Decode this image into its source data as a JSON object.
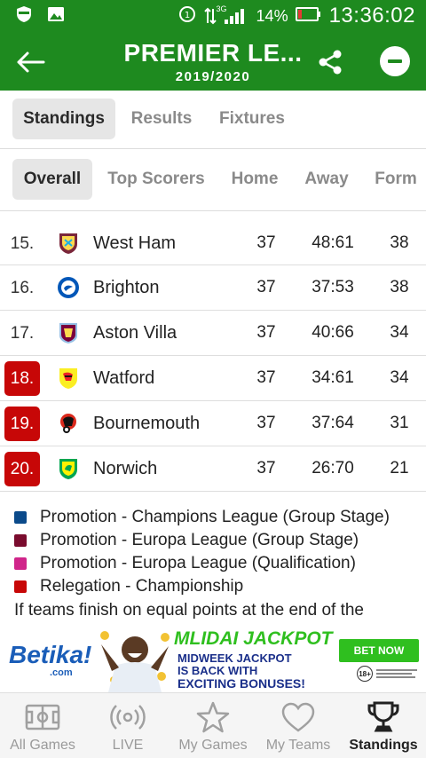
{
  "status_bar": {
    "battery": "14%",
    "network": "3G",
    "time": "13:36:02"
  },
  "app_bar": {
    "title": "PREMIER LE...",
    "subtitle": "2019/2020",
    "back_icon": "arrow-left-icon",
    "share_icon": "share-icon",
    "minus_icon": "minus-circle-icon"
  },
  "main_tabs": [
    {
      "label": "Standings",
      "active": true
    },
    {
      "label": "Results",
      "active": false
    },
    {
      "label": "Fixtures",
      "active": false
    }
  ],
  "sub_tabs": [
    {
      "label": "Overall",
      "active": true
    },
    {
      "label": "Top Scorers",
      "active": false
    },
    {
      "label": "Home",
      "active": false
    },
    {
      "label": "Away",
      "active": false
    },
    {
      "label": "Form",
      "active": false
    }
  ],
  "standings": [
    {
      "pos": "15.",
      "team": "West Ham",
      "played": "37",
      "goals": "48:61",
      "points": "38",
      "zone": null,
      "crest_color": "#7a263a"
    },
    {
      "pos": "16.",
      "team": "Brighton",
      "played": "37",
      "goals": "37:53",
      "points": "38",
      "zone": null,
      "crest_color": "#0057b8"
    },
    {
      "pos": "17.",
      "team": "Aston Villa",
      "played": "37",
      "goals": "40:66",
      "points": "34",
      "zone": null,
      "crest_color": "#95bfe5"
    },
    {
      "pos": "18.",
      "team": "Watford",
      "played": "37",
      "goals": "34:61",
      "points": "34",
      "zone": "relegation",
      "crest_color": "#fbee23"
    },
    {
      "pos": "19.",
      "team": "Bournemouth",
      "played": "37",
      "goals": "37:64",
      "points": "31",
      "zone": "relegation",
      "crest_color": "#da291c"
    },
    {
      "pos": "20.",
      "team": "Norwich",
      "played": "37",
      "goals": "26:70",
      "points": "21",
      "zone": "relegation",
      "crest_color": "#00a650"
    }
  ],
  "legend": [
    {
      "label": "Promotion - Champions League (Group Stage)",
      "color": "#0b4a8a"
    },
    {
      "label": "Promotion - Europa League (Group Stage)",
      "color": "#7a0c2e"
    },
    {
      "label": "Promotion - Europa League (Qualification)",
      "color": "#d0258a"
    },
    {
      "label": "Relegation - Championship",
      "color": "#c70707"
    }
  ],
  "legend_note": "If teams finish on equal points at the end of the",
  "ad": {
    "logo": "Betika!",
    "logo_domain": ".com",
    "headline": "MLIDAI JACKPOT",
    "line1": "MIDWEEK JACKPOT",
    "line2": "IS BACK WITH",
    "line3": "EXCITING BONUSES!",
    "cta": "BET NOW",
    "age": "18+"
  },
  "bottom_nav": [
    {
      "label": "All Games",
      "icon": "pitch-icon",
      "active": false
    },
    {
      "label": "LIVE",
      "icon": "live-broadcast-icon",
      "active": false
    },
    {
      "label": "My Games",
      "icon": "star-icon",
      "active": false
    },
    {
      "label": "My Teams",
      "icon": "heart-icon",
      "active": false
    },
    {
      "label": "Standings",
      "icon": "trophy-icon",
      "active": true
    }
  ],
  "colors": {
    "brand_green": "#1e8a1f",
    "relegation_red": "#c70707"
  }
}
